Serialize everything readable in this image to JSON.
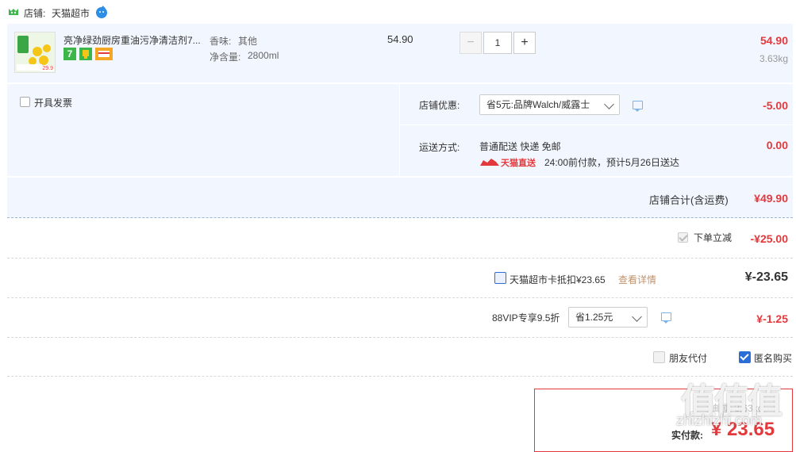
{
  "store": {
    "label": "店铺:",
    "name": "天猫超市"
  },
  "item": {
    "title": "亮净绿劲厨房重油污净清洁剂7...",
    "thumb_tag": "29.9",
    "attr_scent_label": "香味:",
    "attr_scent_value": "其他",
    "attr_volume_label": "净含量:",
    "attr_volume_value": "2800ml",
    "unit_price": "54.90",
    "quantity": "1",
    "minus": "−",
    "plus": "+",
    "subtotal": "54.90",
    "weight": "3.63kg",
    "badge_seven": "7"
  },
  "invoice": {
    "label": "开具发票"
  },
  "shop_discount": {
    "label": "店铺优惠:",
    "selected": "省5元:品牌Walch/威露士",
    "amount": "-5.00"
  },
  "shipping": {
    "label": "运送方式:",
    "method": "普通配送 快递 免邮",
    "brand_tag": "天猫直送",
    "eta": "24:00前付款，预计5月26日送达",
    "amount": "0.00"
  },
  "shop_total": {
    "label": "店铺合计(含运费)",
    "amount": "¥49.90"
  },
  "instant_discount": {
    "label": "下单立减",
    "amount": "-¥25.00",
    "checked": true
  },
  "tmall_card": {
    "label": "天猫超市卡抵扣¥23.65",
    "detail_link": "查看详情",
    "amount": "¥-23.65",
    "checked": false
  },
  "vip": {
    "label": "88VIP专享9.5折",
    "selected": "省1.25元",
    "amount": "¥-1.25"
  },
  "options": {
    "friend_pay": "朋友代付",
    "anonymous": "匿名购买",
    "friend_checked": false,
    "anon_checked": true
  },
  "payment": {
    "label": "实付款:",
    "amount": "¥ 23.65",
    "watermark": "值值值",
    "watermark_sub": "zhizhizhi.com",
    "partial_text": "邮重 3.63kg"
  },
  "colors": {
    "accent_red": "#e4393c",
    "light_blue_bg": "#f2f7ff",
    "blue_check": "#2b6fd6"
  }
}
